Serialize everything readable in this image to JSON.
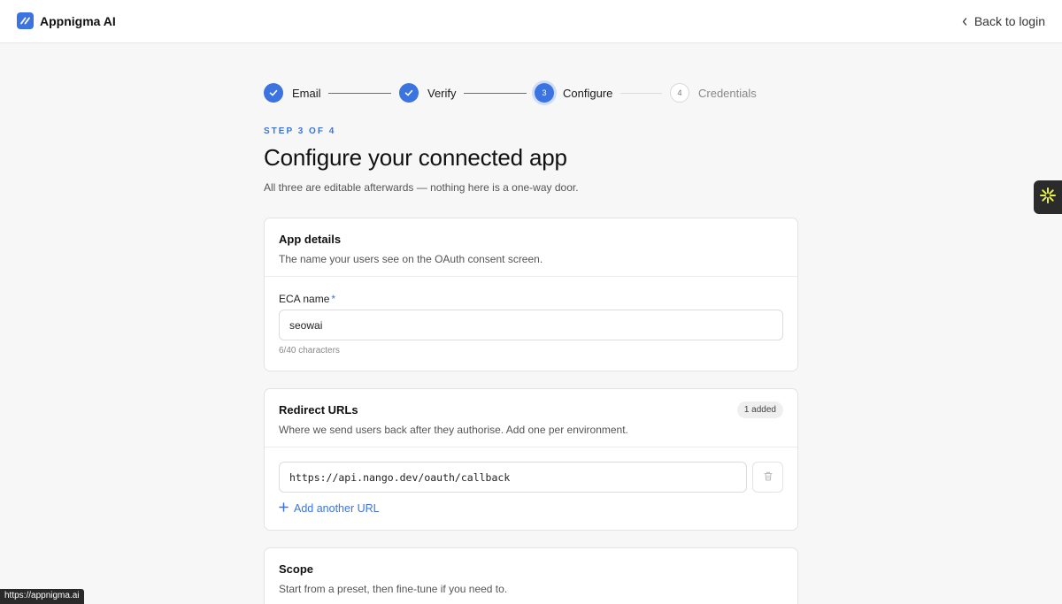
{
  "app": {
    "name": "Appnigma AI"
  },
  "nav": {
    "back_label": "Back to login"
  },
  "stepper": {
    "steps": [
      {
        "label": "Email",
        "state": "done"
      },
      {
        "label": "Verify",
        "state": "done"
      },
      {
        "number": "3",
        "label": "Configure",
        "state": "current"
      },
      {
        "number": "4",
        "label": "Credentials",
        "state": "todo"
      }
    ]
  },
  "page": {
    "eyebrow": "STEP 3 OF 4",
    "title": "Configure your connected app",
    "subtitle": "All three are editable afterwards — nothing here is a one-way door."
  },
  "app_details": {
    "title": "App details",
    "description": "The name your users see on the OAuth consent screen.",
    "field_label": "ECA name",
    "required_mark": "*",
    "value": "seowai",
    "char_count": "6/40 characters"
  },
  "redirect_urls": {
    "title": "Redirect URLs",
    "badge": "1 added",
    "description": "Where we send users back after they authorise. Add one per environment.",
    "urls": [
      "https://api.nango.dev/oauth/callback"
    ],
    "add_label": "Add another URL"
  },
  "scope": {
    "title": "Scope",
    "description": "Start from a preset, then fine-tune if you need to."
  },
  "status_bar": {
    "url": "https://appnigma.ai"
  },
  "colors": {
    "accent": "#3b74e0",
    "background": "#f7f7f7",
    "fab": "#2b2b2b",
    "fab_icon": "#e8f04a"
  }
}
